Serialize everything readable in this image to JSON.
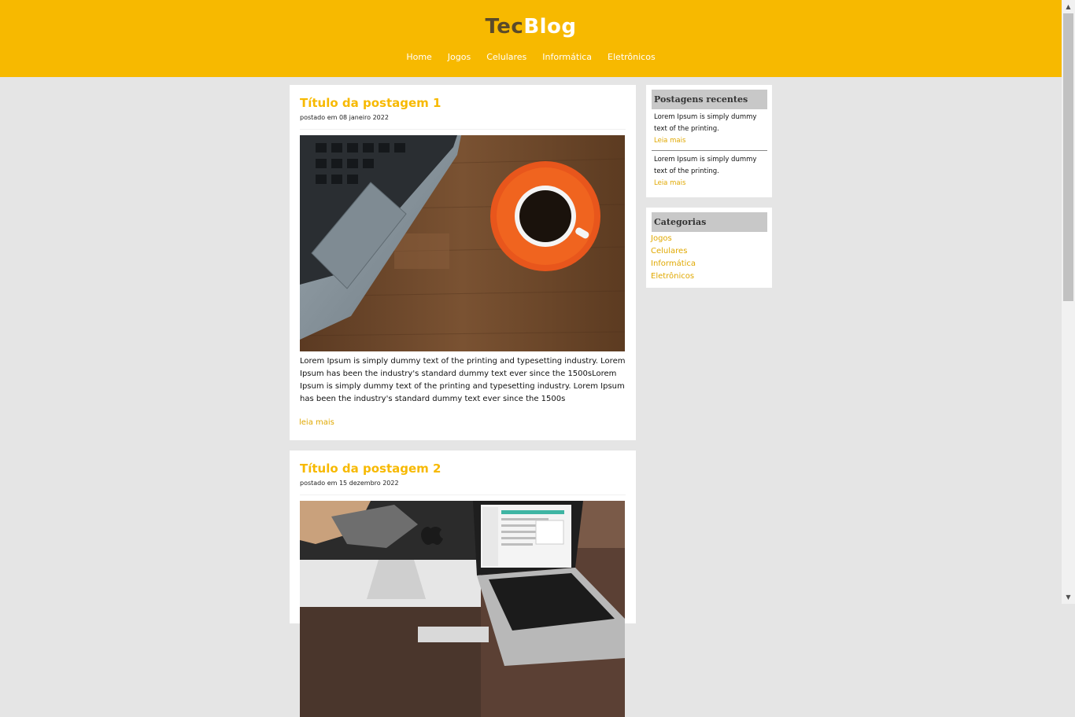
{
  "header": {
    "logo_part1": "Tec",
    "logo_part2": "Blog",
    "nav": [
      "Home",
      "Jogos",
      "Celulares",
      "Informática",
      "Eletrônicos"
    ]
  },
  "posts": [
    {
      "title": "Título da postagem 1",
      "date": "postado em 08 janeiro 2022",
      "text": "Lorem Ipsum is simply dummy text of the printing and typesetting industry. Lorem Ipsum has been the industry's standard dummy text ever since the 1500sLorem Ipsum is simply dummy text of the printing and typesetting industry. Lorem Ipsum has been the industry's standard dummy text ever since the 1500s",
      "read_more": "leia mais"
    },
    {
      "title": "Título da postagem 2",
      "date": "postado em 15 dezembro 2022"
    }
  ],
  "sidebar": {
    "recent": {
      "title": "Postagens recentes",
      "items": [
        {
          "text": "Lorem Ipsum is simply dummy text of the printing.",
          "link": "Leia mais"
        },
        {
          "text": "Lorem Ipsum is simply dummy text of the printing.",
          "link": "Leia mais"
        }
      ]
    },
    "categories": {
      "title": "Categorias",
      "items": [
        "Jogos",
        "Celulares",
        "Informática",
        "Eletrônicos"
      ]
    }
  },
  "colors": {
    "accent": "#f7b900",
    "background": "#e5e5e5",
    "logo_dark": "#5a4a2a"
  }
}
